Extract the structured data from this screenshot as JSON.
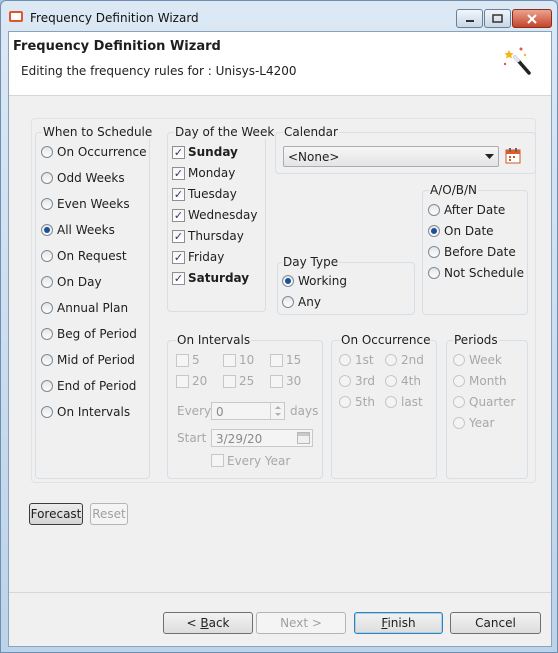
{
  "window": {
    "title": "Frequency Definition Wizard"
  },
  "header": {
    "title": "Frequency Definition Wizard",
    "subtitle": "Editing the frequency rules for : Unisys-L4200",
    "icon": "magic-wand-icon"
  },
  "when_to_schedule": {
    "label": "When to Schedule",
    "selected": "All Weeks",
    "options": [
      "On Occurrence",
      "Odd Weeks",
      "Even Weeks",
      "All Weeks",
      "On Request",
      "On Day",
      "Annual Plan",
      "Beg of Period",
      "Mid of Period",
      "End of Period",
      "On Intervals"
    ]
  },
  "day_of_week": {
    "label": "Day of the Week",
    "days": [
      {
        "name": "Sunday",
        "checked": true,
        "bold": true
      },
      {
        "name": "Monday",
        "checked": true,
        "bold": false
      },
      {
        "name": "Tuesday",
        "checked": true,
        "bold": false
      },
      {
        "name": "Wednesday",
        "checked": true,
        "bold": false
      },
      {
        "name": "Thursday",
        "checked": true,
        "bold": false
      },
      {
        "name": "Friday",
        "checked": true,
        "bold": false
      },
      {
        "name": "Saturday",
        "checked": true,
        "bold": true
      }
    ]
  },
  "calendar": {
    "label": "Calendar",
    "value": "<None>",
    "icon": "calendar-icon"
  },
  "day_type": {
    "label": "Day Type",
    "selected": "Working",
    "options": [
      "Working",
      "Any"
    ]
  },
  "aobn": {
    "label": "A/O/B/N",
    "selected": "On Date",
    "options": [
      "After Date",
      "On Date",
      "Before Date",
      "Not Schedule"
    ]
  },
  "on_intervals": {
    "label": "On Intervals",
    "values": [
      "5",
      "10",
      "15",
      "20",
      "25",
      "30"
    ],
    "every_label": "Every",
    "every_value": "0",
    "days_label": "days",
    "start_label": "Start",
    "start_value": "3/29/20",
    "every_year_label": "Every Year"
  },
  "on_occurrence": {
    "label": "On Occurrence",
    "options": [
      "1st",
      "2nd",
      "3rd",
      "4th",
      "5th",
      "last"
    ]
  },
  "periods": {
    "label": "Periods",
    "options": [
      "Week",
      "Month",
      "Quarter",
      "Year"
    ]
  },
  "buttons": {
    "forecast": "Forecast",
    "reset": "Reset",
    "back_pre": "< ",
    "back_u": "B",
    "back_post": "ack",
    "next": "Next >",
    "finish_u": "F",
    "finish_post": "inish",
    "cancel": "Cancel"
  }
}
